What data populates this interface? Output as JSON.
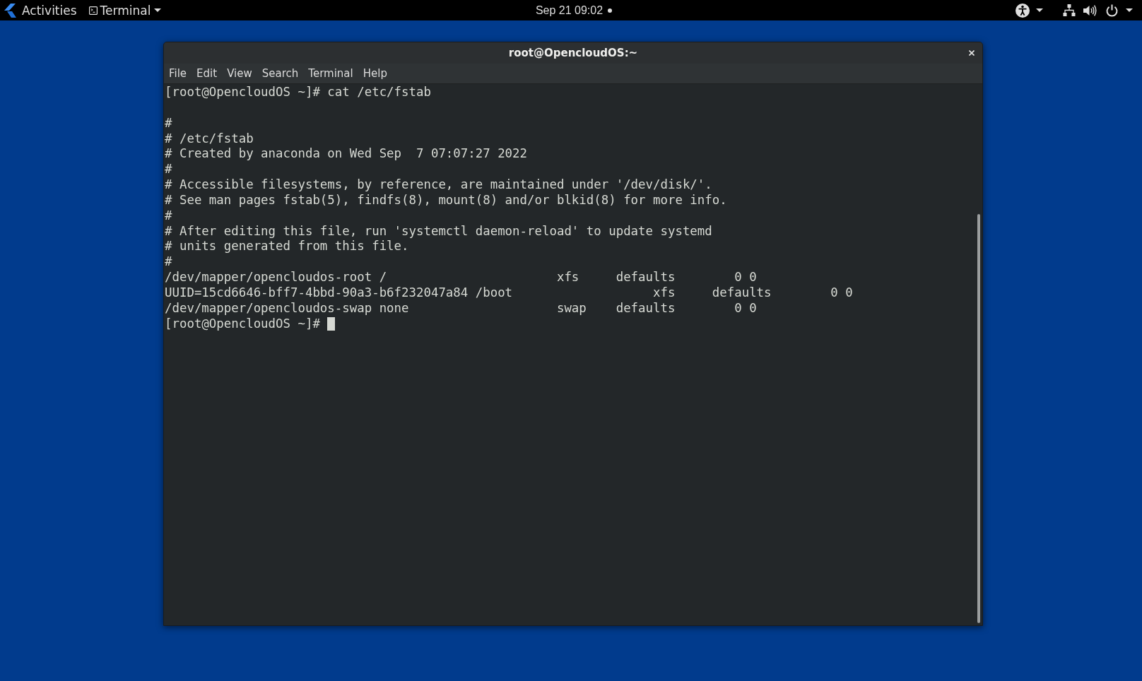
{
  "top_bar": {
    "activities": "Activities",
    "app_menu": "Terminal",
    "clock": "Sep 21 09:02",
    "notification_dot": true
  },
  "window": {
    "title": "root@OpencloudOS:~",
    "menu": [
      "File",
      "Edit",
      "View",
      "Search",
      "Terminal",
      "Help"
    ]
  },
  "terminal": {
    "lines": [
      {
        "kind": "text",
        "text": "[root@OpencloudOS ~]# cat /etc/fstab"
      },
      {
        "kind": "blank"
      },
      {
        "kind": "text",
        "text": "#"
      },
      {
        "kind": "text",
        "text": "# /etc/fstab"
      },
      {
        "kind": "text",
        "text": "# Created by anaconda on Wed Sep  7 07:07:27 2022"
      },
      {
        "kind": "text",
        "text": "#"
      },
      {
        "kind": "text",
        "text": "# Accessible filesystems, by reference, are maintained under '/dev/disk/'."
      },
      {
        "kind": "text",
        "text": "# See man pages fstab(5), findfs(8), mount(8) and/or blkid(8) for more info."
      },
      {
        "kind": "text",
        "text": "#"
      },
      {
        "kind": "text",
        "text": "# After editing this file, run 'systemctl daemon-reload' to update systemd"
      },
      {
        "kind": "text",
        "text": "# units generated from this file."
      },
      {
        "kind": "text",
        "text": "#"
      },
      {
        "kind": "text",
        "text": "/dev/mapper/opencloudos-root /                       xfs     defaults        0 0"
      },
      {
        "kind": "text",
        "text": "UUID=15cd6646-bff7-4bbd-90a3-b6f232047a84 /boot                   xfs     defaults        0 0"
      },
      {
        "kind": "text",
        "text": "/dev/mapper/opencloudos-swap none                    swap    defaults        0 0"
      }
    ],
    "input": {
      "prompt": "[root@OpencloudOS ~]#",
      "cursor": true
    }
  }
}
